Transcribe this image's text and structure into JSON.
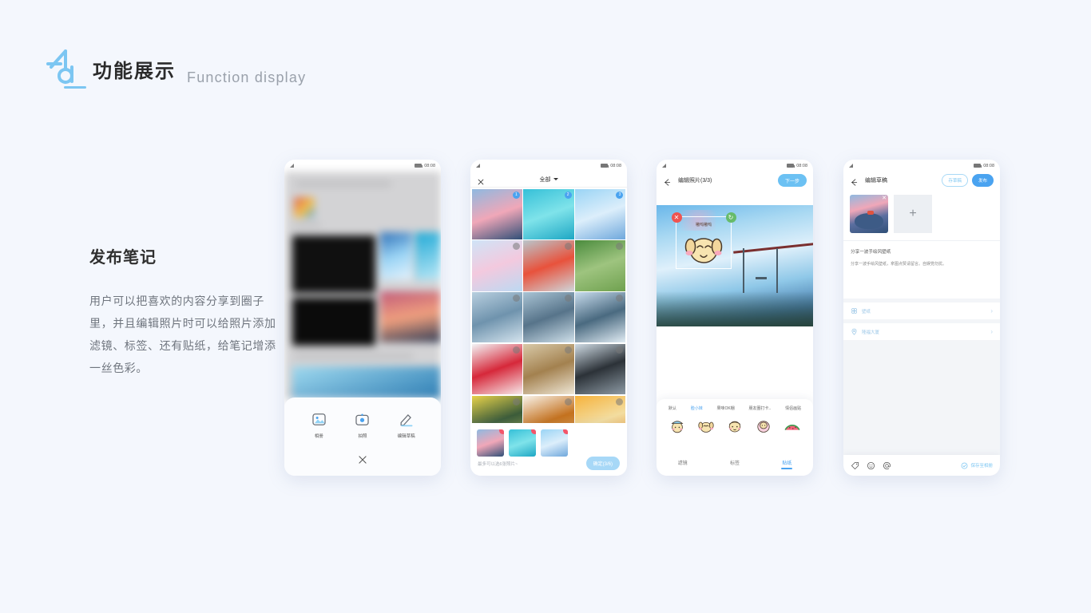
{
  "header": {
    "logo_name": "acl-logo",
    "title_cn": "功能展示",
    "title_en": "Function display",
    "accent": "#7cc6f2"
  },
  "description": {
    "heading": "发布笔记",
    "body": "用户可以把喜欢的内容分享到圈子里，并且编辑照片时可以给照片添加滤镜、标签、还有贴纸，给笔记增添一丝色彩。"
  },
  "status_bar": {
    "time": "08:08"
  },
  "phone1": {
    "sheet": {
      "items": [
        {
          "label": "相册",
          "icon": "image-icon"
        },
        {
          "label": "拍照",
          "icon": "camera-icon"
        },
        {
          "label": "编辑草稿",
          "icon": "pencil-icon"
        }
      ],
      "close_icon": "close-icon"
    }
  },
  "phone2": {
    "close_label": "✕",
    "title": "全部",
    "grid": [
      {
        "badge": "1",
        "selected": true,
        "g": [
          "#8fb9e0",
          "#f0a7b8",
          "#2f4f77"
        ]
      },
      {
        "badge": "2",
        "selected": true,
        "g": [
          "#36c0d8",
          "#7fe3ea",
          "#1ea7c4"
        ]
      },
      {
        "badge": "3",
        "selected": true,
        "g": [
          "#9ad4f5",
          "#dceefb",
          "#6fa8dc"
        ]
      },
      {
        "badge": "",
        "selected": false,
        "g": [
          "#cfe4f7",
          "#f3c9de",
          "#bcd9f2"
        ]
      },
      {
        "badge": "",
        "selected": false,
        "g": [
          "#b9c6cc",
          "#e8523c",
          "#cfd6da"
        ]
      },
      {
        "badge": "",
        "selected": false,
        "g": [
          "#4a8b3d",
          "#9ec47f",
          "#6fa14f"
        ]
      },
      {
        "badge": "",
        "selected": false,
        "g": [
          "#b8cfdf",
          "#6f93ad",
          "#d5e4ee"
        ]
      },
      {
        "badge": "",
        "selected": false,
        "g": [
          "#a9c3d4",
          "#57748a",
          "#cfe0ea"
        ]
      },
      {
        "badge": "",
        "selected": false,
        "g": [
          "#c8dced",
          "#4a6a80",
          "#e1ecf4"
        ]
      },
      {
        "badge": "",
        "selected": false,
        "g": [
          "#f3f4f6",
          "#d6283a",
          "#f7e9ea"
        ]
      },
      {
        "badge": "",
        "selected": false,
        "g": [
          "#d8c9a8",
          "#a3814f",
          "#efe7d6"
        ]
      },
      {
        "badge": "",
        "selected": false,
        "g": [
          "#cfdbe4",
          "#2c3238",
          "#8d9aa4"
        ]
      },
      {
        "badge": "",
        "selected": false,
        "g": [
          "#e8d34a",
          "#3c5c3a",
          "#9aa84b"
        ]
      },
      {
        "badge": "",
        "selected": false,
        "g": [
          "#f8f3ea",
          "#c4721f",
          "#e0a85a"
        ]
      },
      {
        "badge": "",
        "selected": false,
        "g": [
          "#f6b23c",
          "#f3dda0",
          "#e9902a"
        ]
      }
    ],
    "selected_thumbs": [
      {
        "g": [
          "#8fb9e0",
          "#f0a7b8",
          "#2f4f77"
        ],
        "remove": "−"
      },
      {
        "g": [
          "#36c0d8",
          "#7fe3ea",
          "#1ea7c4"
        ],
        "remove": "−"
      },
      {
        "g": [
          "#9ad4f5",
          "#dceefb",
          "#6fa8dc"
        ],
        "remove": "−"
      }
    ],
    "hint": "最多可以选6张照片~",
    "confirm_label": "确定(3/6)"
  },
  "phone3": {
    "back_icon": "back-arrow-icon",
    "title": "编辑照片(3/3)",
    "next_label": "下一步",
    "sticker_text": "嗷呜嗷呜",
    "delete_handle": "✕",
    "rotate_handle": "↻",
    "categories": [
      {
        "label": "默认",
        "active": false
      },
      {
        "label": "脸小妹",
        "active": true
      },
      {
        "label": "果味OK棚",
        "active": false
      },
      {
        "label": "朋友圈打卡..",
        "active": false
      },
      {
        "label": "情侣画贴",
        "active": false
      }
    ],
    "stickers": [
      "sticker-hat-girl",
      "sticker-dog-face",
      "sticker-smile-girl",
      "sticker-blush-girl",
      "sticker-watermelon"
    ],
    "tabs": [
      {
        "label": "滤镜",
        "active": false
      },
      {
        "label": "标签",
        "active": false
      },
      {
        "label": "贴纸",
        "active": true
      }
    ]
  },
  "phone4": {
    "back_icon": "back-arrow-icon",
    "title": "编辑草稿",
    "save_draft_label": "存草稿",
    "publish_label": "发布",
    "image_remove": "✕",
    "add_label": "+",
    "note_title": "分享一波手绘风壁纸",
    "note_body": "分享一波手绘风壁纸，拿图点赞请留言。自娱党勿扰。",
    "list": [
      {
        "icon": "grid-icon",
        "label": "壁纸",
        "chevron": "›"
      },
      {
        "icon": "location-icon",
        "label": "隆福大厦",
        "chevron": "›"
      }
    ],
    "toolbar_icons": [
      "tag-icon",
      "emoji-icon",
      "mention-icon"
    ],
    "save_to_album": "保存至相册"
  }
}
